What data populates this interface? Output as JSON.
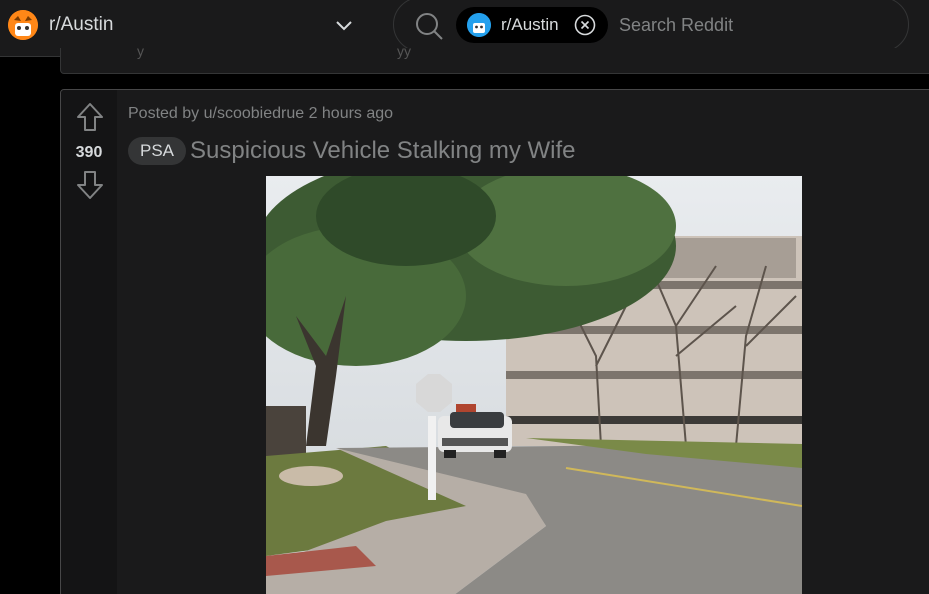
{
  "header": {
    "subreddit_name": "r/Austin",
    "subreddit_avatar_icon": "subreddit-avatar-icon",
    "dropdown_icon": "chevron-down-icon",
    "search": {
      "icon": "search-icon",
      "chip_label": "r/Austin",
      "chip_close_icon": "close-circle-icon",
      "placeholder": "Search Reddit"
    }
  },
  "post": {
    "score": "390",
    "meta": "Posted by u/scoobiedrue 2 hours ago",
    "flair": "PSA",
    "title": "Suspicious Vehicle Stalking my Wife",
    "upvote_icon": "upvote-arrow-icon",
    "downvote_icon": "downvote-arrow-icon",
    "image": "photo of a white car on a curved street near a parking garage"
  },
  "colors": {
    "background": "#000000",
    "surface": "#1a1a1b",
    "border": "#343536",
    "text": "#d7dadc",
    "muted": "#818384",
    "brand_avatar": "#ff8717"
  }
}
